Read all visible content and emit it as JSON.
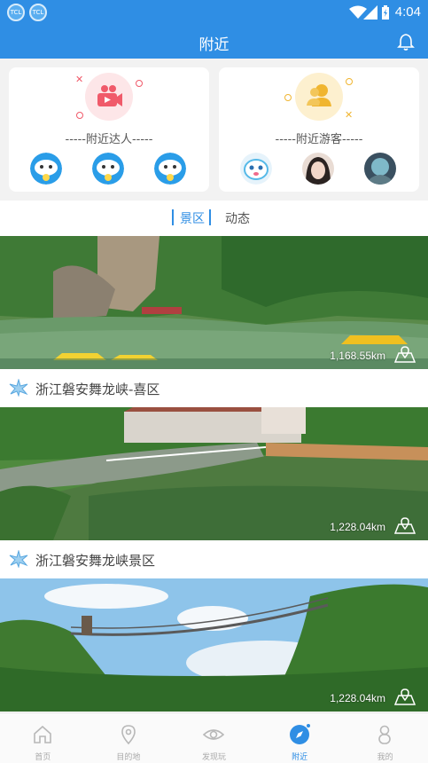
{
  "statusbar": {
    "time": "4:04",
    "app_icons": [
      "TCL",
      "TCL"
    ]
  },
  "header": {
    "title": "附近",
    "notification_icon": "bell-icon"
  },
  "nearby": {
    "experts": {
      "label": "-----附近达人-----",
      "icon": "video-camera-icon",
      "color": "#f05a6a"
    },
    "visitors": {
      "label": "-----附近游客-----",
      "icon": "users-icon",
      "color": "#f0b530"
    }
  },
  "tabs": [
    {
      "label": "景区",
      "active": true
    },
    {
      "label": "动态",
      "active": false
    }
  ],
  "feed": [
    {
      "title": "",
      "distance": "1,168.55km"
    },
    {
      "title": "浙江磐安舞龙峡-喜区",
      "distance": "1,228.04km"
    },
    {
      "title": "浙江磐安舞龙峡景区",
      "distance": "1,228.04km"
    }
  ],
  "bottom_nav": [
    {
      "label": "首页",
      "icon": "home-icon",
      "active": false
    },
    {
      "label": "目的地",
      "icon": "location-pin-icon",
      "active": false
    },
    {
      "label": "发现玩",
      "icon": "eye-icon",
      "active": false
    },
    {
      "label": "附近",
      "icon": "compass-icon",
      "active": true
    },
    {
      "label": "我的",
      "icon": "person-icon",
      "active": false
    }
  ],
  "colors": {
    "primary": "#2f8ee4",
    "background": "#f2f2f2"
  }
}
